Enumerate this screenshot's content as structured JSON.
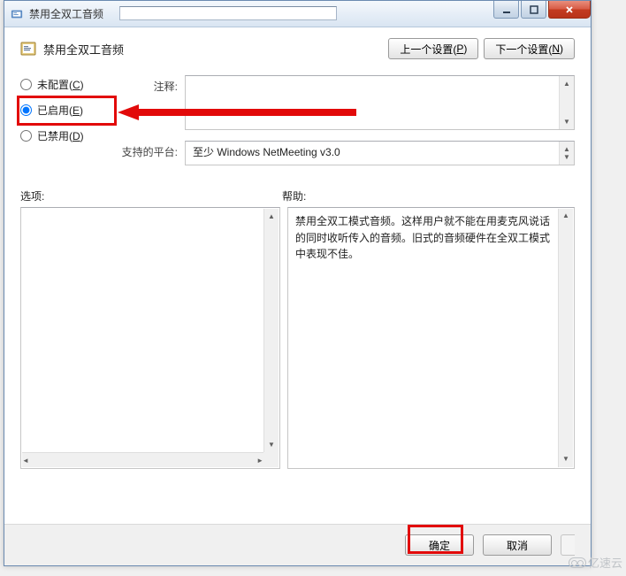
{
  "window": {
    "title": "禁用全双工音频"
  },
  "header": {
    "title": "禁用全双工音频",
    "prev_button": "上一个设置(",
    "prev_key": "P",
    "prev_suffix": ")",
    "next_button": "下一个设置(",
    "next_key": "N",
    "next_suffix": ")"
  },
  "radios": {
    "not_configured": "未配置(",
    "not_configured_key": "C",
    "not_configured_suffix": ")",
    "enabled": "已启用(",
    "enabled_key": "E",
    "enabled_suffix": ")",
    "disabled": "已禁用(",
    "disabled_key": "D",
    "disabled_suffix": ")"
  },
  "labels": {
    "comment": "注释:",
    "platform": "支持的平台:",
    "options": "选项:",
    "help": "帮助:"
  },
  "values": {
    "platform_text": "至少 Windows NetMeeting v3.0"
  },
  "help_text": "禁用全双工模式音频。这样用户就不能在用麦克风说话的同时收听传入的音频。旧式的音频硬件在全双工模式中表现不佳。",
  "footer": {
    "ok": "确定",
    "cancel": "取消"
  },
  "watermark": "亿速云"
}
